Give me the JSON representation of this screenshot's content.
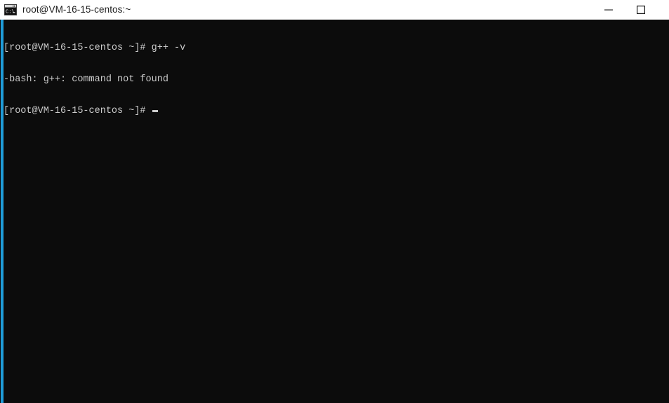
{
  "window": {
    "title": "root@VM-16-15-centos:~",
    "app_icon": "console-icon",
    "background_color": "#0c0c0c",
    "titlebar_color": "#ffffff",
    "accent_color": "#1f9cd9",
    "text_color": "#cccccc"
  },
  "titlebar": {
    "minimize_label": "—",
    "maximize_label": "□",
    "close_label": "✕"
  },
  "terminal": {
    "prompt": "[root@VM-16-15-centos ~]#",
    "lines": [
      "[root@VM-16-15-centos ~]# g++ -v",
      "-bash: g++: command not found",
      "[root@VM-16-15-centos ~]# "
    ],
    "command": "g++ -v",
    "error": "-bash: g++: command not found",
    "cursor_line_index": 2
  }
}
